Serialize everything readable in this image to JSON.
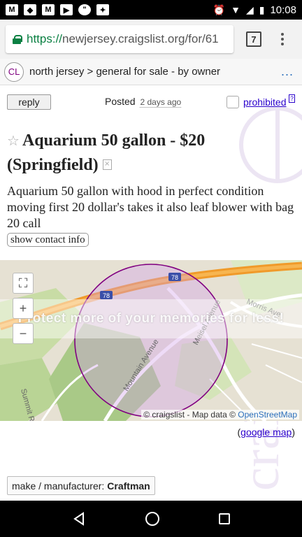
{
  "status_bar": {
    "time": "10:08",
    "left_icons": [
      "gmail-icon",
      "app-icon",
      "gmail-icon",
      "youtube-icon",
      "chat-icon",
      "app-icon"
    ],
    "right_icons": [
      "alarm-icon",
      "wifi-icon",
      "signal-icon",
      "battery-icon"
    ]
  },
  "browser": {
    "url_scheme": "https://",
    "url_rest": "newjersey.craigslist.org/for/61",
    "tab_count": "7"
  },
  "breadcrumb": {
    "logo": "CL",
    "path": "north jersey > general for sale - by owner",
    "more": "..."
  },
  "posting": {
    "reply_label": "reply",
    "posted_label": "Posted",
    "posted_date": "2 days ago",
    "prohibited_label": "prohibited",
    "prohibited_sup": "?",
    "title": "Aquarium 50 gallon - $20",
    "location": "(Springfield)",
    "body": "Aquarium 50 gallon with hood in perfect condition moving first 20 dollar's takes it also leaf blower with bag 20 call",
    "show_contact_label": "show contact info"
  },
  "map": {
    "overlay_text": "Protect more of your memories for less!",
    "attribution_prefix": "© craigslist - Map data ©",
    "attribution_link": "OpenStreetMap",
    "road_labels": [
      "Mountain Avenue",
      "Meisel Avenue",
      "Morris Ave",
      "Summit Rd"
    ],
    "highway": "78"
  },
  "links": {
    "google_map_open": "(",
    "google_map": "google map",
    "google_map_close": ")"
  },
  "attributes": {
    "make_label": "make / manufacturer:",
    "make_value": "Craftman"
  },
  "colors": {
    "map_circle": "#800080",
    "map_circle_fill": "rgba(200,150,230,0.35)",
    "highway": "#f09a2a"
  }
}
